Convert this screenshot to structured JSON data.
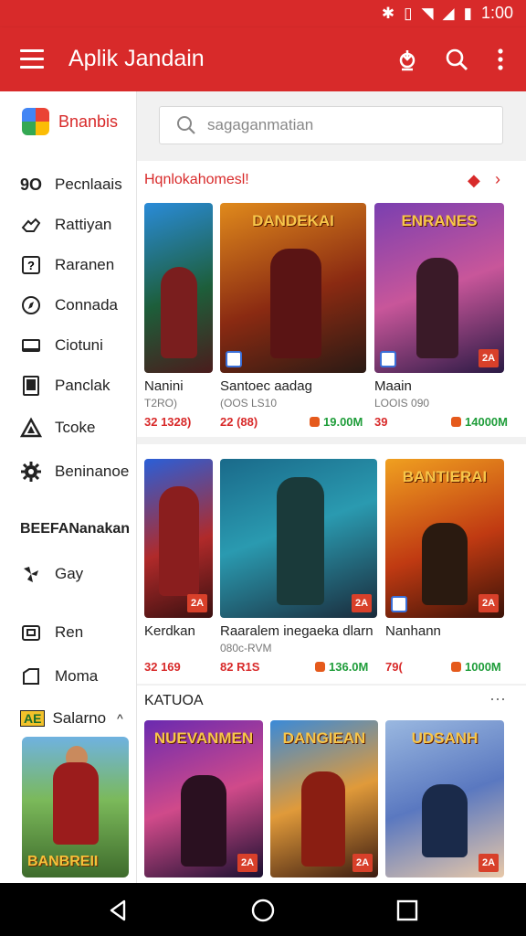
{
  "status_bar": {
    "time": "1:00"
  },
  "app_bar": {
    "title": "Aplik Jandain",
    "actions": [
      "download-icon",
      "search-icon",
      "more-vert-icon"
    ]
  },
  "sidebar": {
    "brand": "Bnanbis",
    "items": [
      {
        "label": "Pecnlaais",
        "icon": "text-90-icon",
        "glyph": "9O"
      },
      {
        "label": "Rattiyan",
        "icon": "hand-icon"
      },
      {
        "label": "Raranen",
        "icon": "question-box-icon"
      },
      {
        "label": "Connada",
        "icon": "compass-icon"
      },
      {
        "label": "Ciotuni",
        "icon": "monitor-icon"
      },
      {
        "label": "Panclak",
        "icon": "book-icon"
      },
      {
        "label": "Tcoke",
        "icon": "triangle-icon"
      },
      {
        "label": "Beninanoe",
        "icon": "gear-icon"
      }
    ],
    "section_label": "BEEFANanakan",
    "items2": [
      {
        "label": "Gay",
        "icon": "pinwheel-icon"
      },
      {
        "label": "Ren",
        "icon": "card-icon"
      },
      {
        "label": "Moma",
        "icon": "tag-icon"
      }
    ],
    "expander": {
      "label": "Salarno",
      "badge": "AE"
    },
    "promo_card_title": "BANBREII"
  },
  "search": {
    "placeholder": "sagaganmatian"
  },
  "sections": [
    {
      "title": "Hqnlokahomesl!",
      "apps": [
        {
          "name": "Nanini",
          "sub": "T2RO)",
          "price": "32 1328)",
          "downloads": "",
          "thumb_title": ""
        },
        {
          "name": "Santoec aadag",
          "sub": "(OOS LS10",
          "price": "22 (88)",
          "downloads": "19.00M",
          "thumb_title": "DANDEKAI"
        },
        {
          "name": "Maain",
          "sub": "LOOIS 090",
          "price": "39",
          "downloads": "14000M",
          "thumb_title": "ENRANES"
        }
      ]
    },
    {
      "title": "",
      "apps": [
        {
          "name": "Kerdkan",
          "sub": "",
          "price": "32 169",
          "downloads": "",
          "thumb_title": ""
        },
        {
          "name": "Raaralem inegaeka dlarn",
          "sub": "080c-RVM",
          "price": "82 R1S",
          "downloads": "136.0M",
          "thumb_title": ""
        },
        {
          "name": "Nanhann",
          "sub": "",
          "price": "79(",
          "downloads": "1000M",
          "thumb_title": "BANTIERAI"
        }
      ]
    },
    {
      "title": "KATUOA",
      "apps": [
        {
          "thumb_title": "NUEVANMEN"
        },
        {
          "thumb_title": "DANGIEAN"
        },
        {
          "thumb_title": "UDSANH"
        }
      ]
    }
  ],
  "colors": {
    "accent": "#d82a2a",
    "download_green": "#1f9d3a"
  }
}
